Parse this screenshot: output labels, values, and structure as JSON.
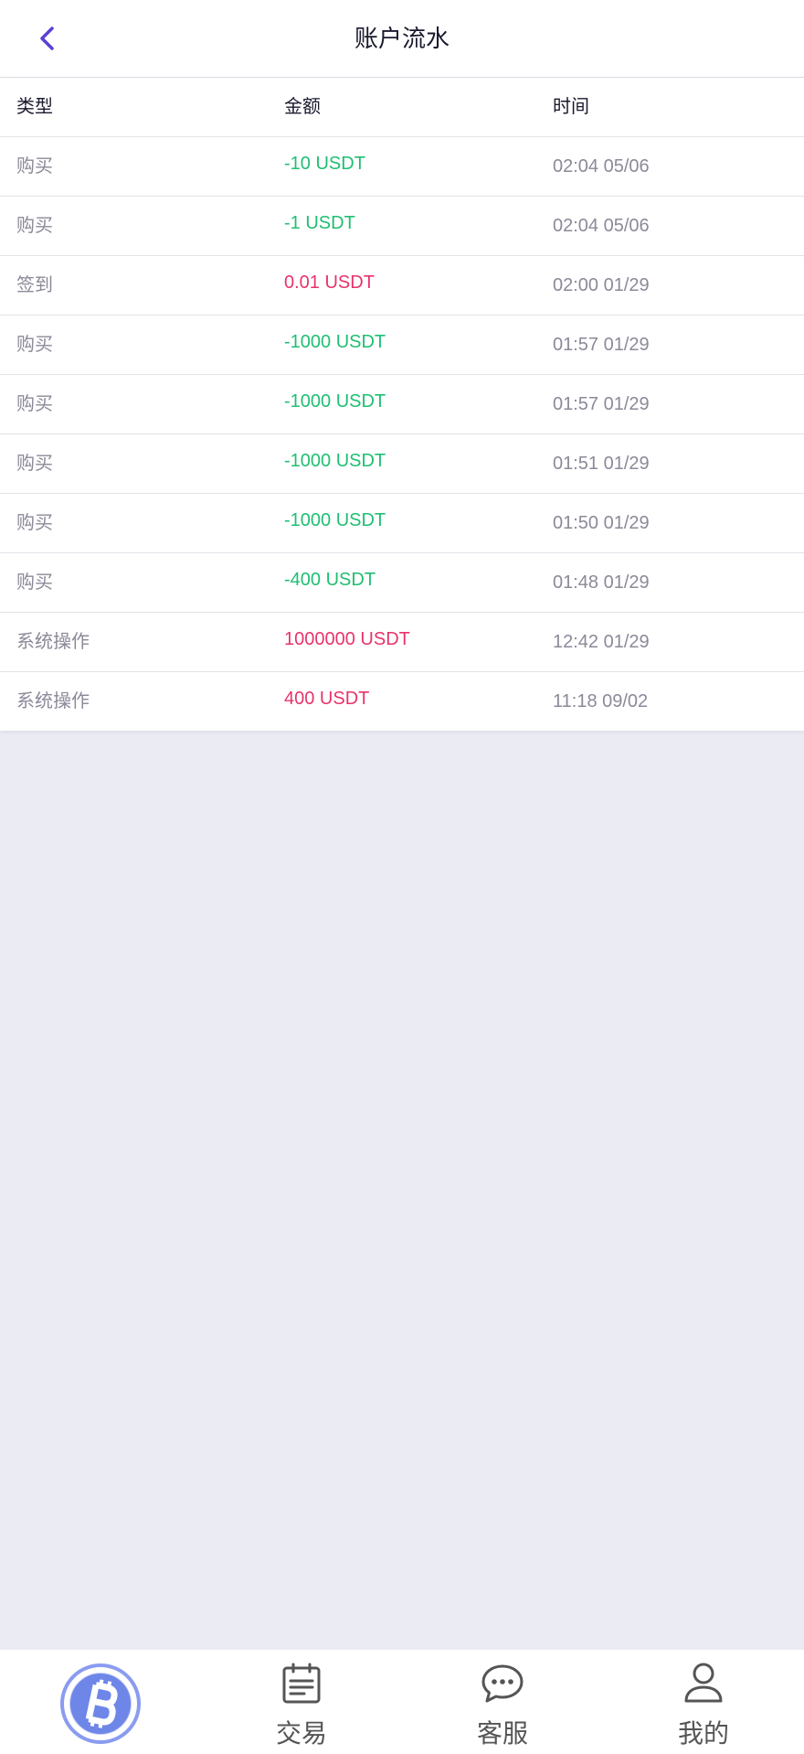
{
  "header": {
    "title": "账户流水"
  },
  "table": {
    "columns": [
      "类型",
      "金额",
      "时间"
    ],
    "rows": [
      {
        "type": "购买",
        "amount": "-10 USDT",
        "time": "02:04 05/06",
        "direction": "out"
      },
      {
        "type": "购买",
        "amount": "-1 USDT",
        "time": "02:04 05/06",
        "direction": "out"
      },
      {
        "type": "签到",
        "amount": "0.01 USDT",
        "time": "02:00 01/29",
        "direction": "in"
      },
      {
        "type": "购买",
        "amount": "-1000 USDT",
        "time": "01:57 01/29",
        "direction": "out"
      },
      {
        "type": "购买",
        "amount": "-1000 USDT",
        "time": "01:57 01/29",
        "direction": "out"
      },
      {
        "type": "购买",
        "amount": "-1000 USDT",
        "time": "01:51 01/29",
        "direction": "out"
      },
      {
        "type": "购买",
        "amount": "-1000 USDT",
        "time": "01:50 01/29",
        "direction": "out"
      },
      {
        "type": "购买",
        "amount": "-400 USDT",
        "time": "01:48 01/29",
        "direction": "out"
      },
      {
        "type": "系统操作",
        "amount": "1000000 USDT",
        "time": "12:42 01/29",
        "direction": "in"
      },
      {
        "type": "系统操作",
        "amount": "400 USDT",
        "time": "11:18 09/02",
        "direction": "in"
      }
    ]
  },
  "tabbar": {
    "items": [
      {
        "label": "",
        "icon": "bitcoin-icon"
      },
      {
        "label": "交易",
        "icon": "clipboard-list-icon"
      },
      {
        "label": "客服",
        "icon": "chat-bubble-icon"
      },
      {
        "label": "我的",
        "icon": "user-icon"
      }
    ]
  },
  "colors": {
    "accent": "#5b3fd6",
    "negative": "#1fbf72",
    "positive": "#e8336b",
    "background": "#ebebf3",
    "bitcoin": "#6e86e8"
  }
}
